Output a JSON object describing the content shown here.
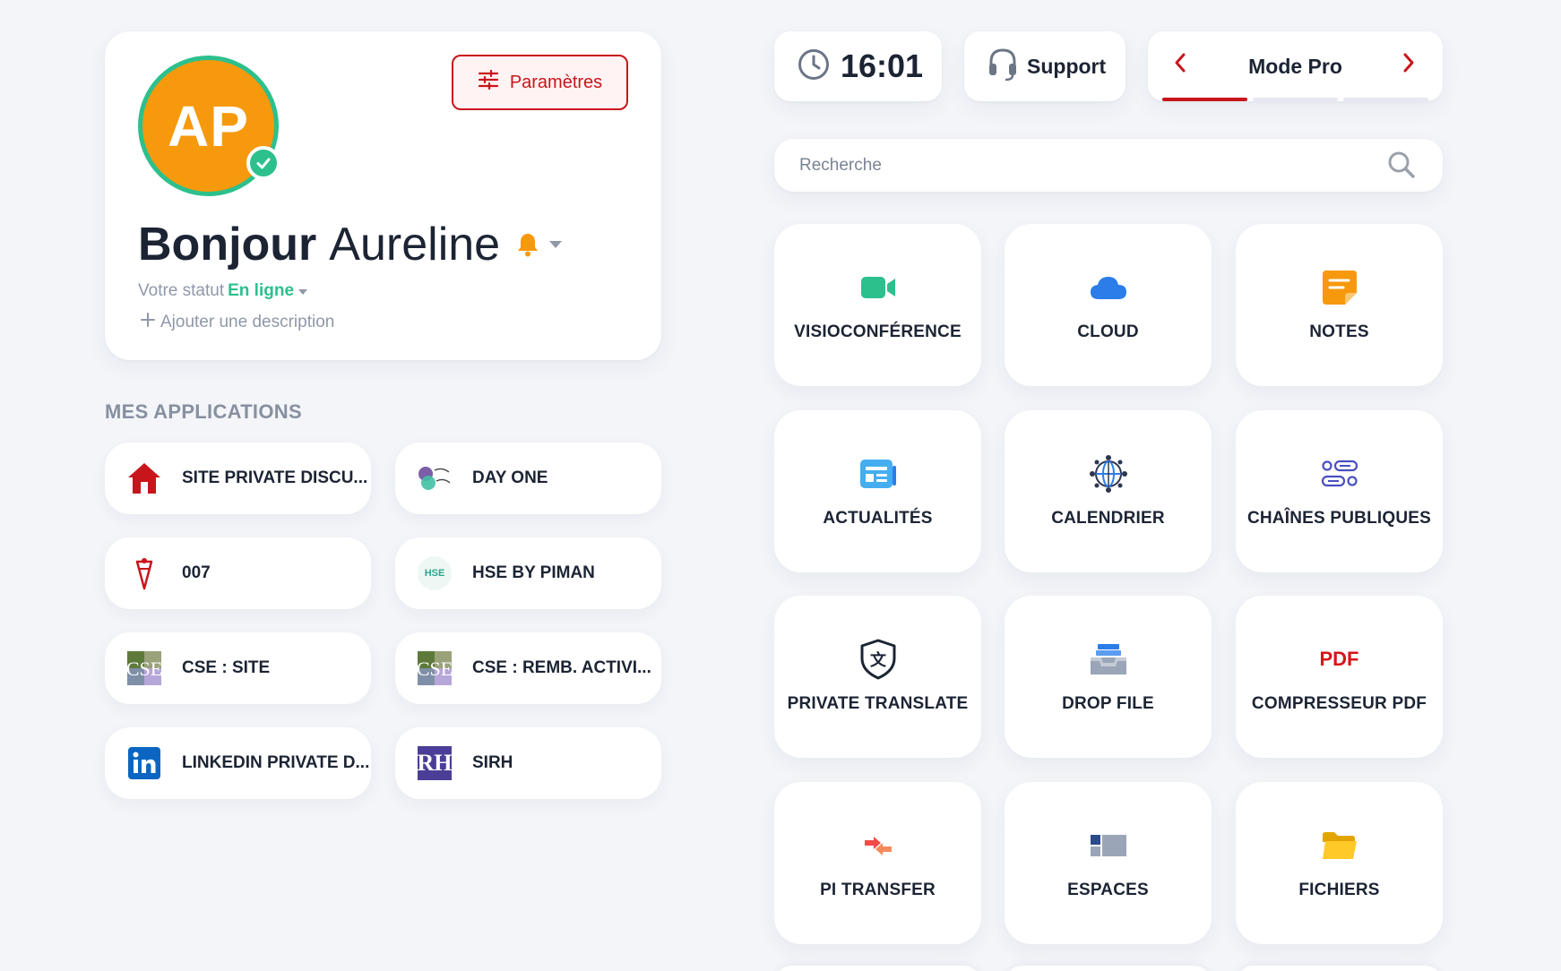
{
  "profile": {
    "initials": "AP",
    "settings_label": "Paramètres",
    "greeting_prefix": "Bonjour",
    "user_name": "Aureline",
    "status_prefix": "Votre statut",
    "status_value": "En ligne",
    "add_description": "Ajouter une description"
  },
  "apps": {
    "title": "MES APPLICATIONS",
    "items": [
      {
        "label": "SITE PRIVATE DISCU...",
        "icon": "house-icon"
      },
      {
        "label": "DAY ONE",
        "icon": "day-one-logo-icon"
      },
      {
        "label": "007",
        "icon": "compass-pin-icon"
      },
      {
        "label": "HSE BY PIMAN",
        "icon": "hse-logo-icon",
        "logo_text": "HSE"
      },
      {
        "label": "CSE : SITE",
        "icon": "cse-logo-icon"
      },
      {
        "label": "CSE : REMB. ACTIVI...",
        "icon": "cse-logo-icon"
      },
      {
        "label": "LINKEDIN PRIVATE D...",
        "icon": "linkedin-icon"
      },
      {
        "label": "SIRH",
        "icon": "rh-logo-icon",
        "logo_text": "RH"
      }
    ]
  },
  "topbar": {
    "time": "16:01",
    "support_label": "Support",
    "mode_label": "Mode Pro",
    "mode_page_fraction": 0.333
  },
  "search": {
    "placeholder": "Recherche",
    "value": ""
  },
  "tiles": [
    {
      "label": "VISIOCONFÉRENCE",
      "icon": "video-camera-icon"
    },
    {
      "label": "CLOUD",
      "icon": "cloud-icon"
    },
    {
      "label": "NOTES",
      "icon": "note-icon"
    },
    {
      "label": "ACTUALITÉS",
      "icon": "news-icon"
    },
    {
      "label": "CALENDRIER",
      "icon": "globe-network-icon"
    },
    {
      "label": "CHAÎNES PUBLIQUES",
      "icon": "channels-icon"
    },
    {
      "label": "PRIVATE TRANSLATE",
      "icon": "translate-shield-icon"
    },
    {
      "label": "DROP FILE",
      "icon": "inbox-tray-icon"
    },
    {
      "label": "COMPRESSEUR PDF",
      "icon": "pdf-icon",
      "icon_text": "PDF"
    },
    {
      "label": "PI TRANSFER",
      "icon": "transfer-icon"
    },
    {
      "label": "ESPACES",
      "icon": "spaces-icon"
    },
    {
      "label": "FICHIERS",
      "icon": "folder-icon"
    }
  ],
  "colors": {
    "accent_red": "#c8151b",
    "online_green": "#2cc08d",
    "avatar_orange": "#f7990c"
  }
}
